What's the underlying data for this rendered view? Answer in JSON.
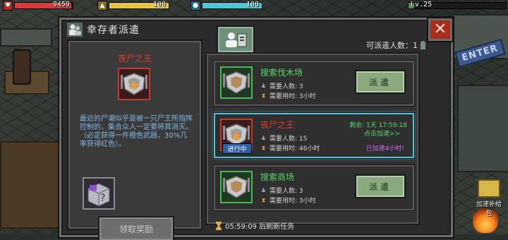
{
  "hud": {
    "health": {
      "value": "9459",
      "fill_pct": 98,
      "color": "#d93a3a",
      "icon": "heart-icon"
    },
    "food": {
      "value": "100",
      "fill_pct": 100,
      "color": "#e7c63e",
      "icon": "food-icon"
    },
    "water": {
      "value": "100",
      "fill_pct": 100,
      "color": "#4dc6d8",
      "icon": "water-icon"
    },
    "level": {
      "value": "Lv.25",
      "fill_pct": 6,
      "color": "#4f8f4a"
    }
  },
  "dialog": {
    "title": "幸存者派遣",
    "close_icon": "close-icon",
    "available_label": "可派遣人数：1",
    "refresh_text": "05:59:09 后刷新任务"
  },
  "detail": {
    "name": "丧尸之王",
    "description": "最近的尸潮似乎是被一只尸王所指挥控制的，集合众人一定要将其消灭。（必定获得一件橙色武器，30%几率获得红色）。",
    "claim_label": "领取奖励"
  },
  "missions": [
    {
      "name": "搜索伐木场",
      "name_color": "#58d66a",
      "people_label": "需要人数: 3",
      "time_label": "需要用时: 3小时",
      "action_label": "派遣",
      "frame": "green"
    },
    {
      "name": "丧尸之王",
      "name_color": "#e53a2c",
      "people_label": "需要人数: 15",
      "time_label": "需要用时: 46小时",
      "status_label": "进行中",
      "remaining_label": "剩余: 1天 17:59:18",
      "speed_label": "点击加速>>",
      "sped_label": "已加速4小时!",
      "frame": "red"
    },
    {
      "name": "搜索商场",
      "name_color": "#58d66a",
      "people_label": "需要人数: 3",
      "time_label": "需要用时: 3小时",
      "action_label": "派遣",
      "frame": "green"
    }
  ],
  "side": {
    "supply_label": "加速补给包",
    "sign_text": "ENTER"
  },
  "colors": {
    "accent_cyan": "#53c2d6",
    "green_text": "#58d66a",
    "red_text": "#e53a2c",
    "purple_text": "#d56cf2",
    "blue_text": "#7fb7e6"
  }
}
